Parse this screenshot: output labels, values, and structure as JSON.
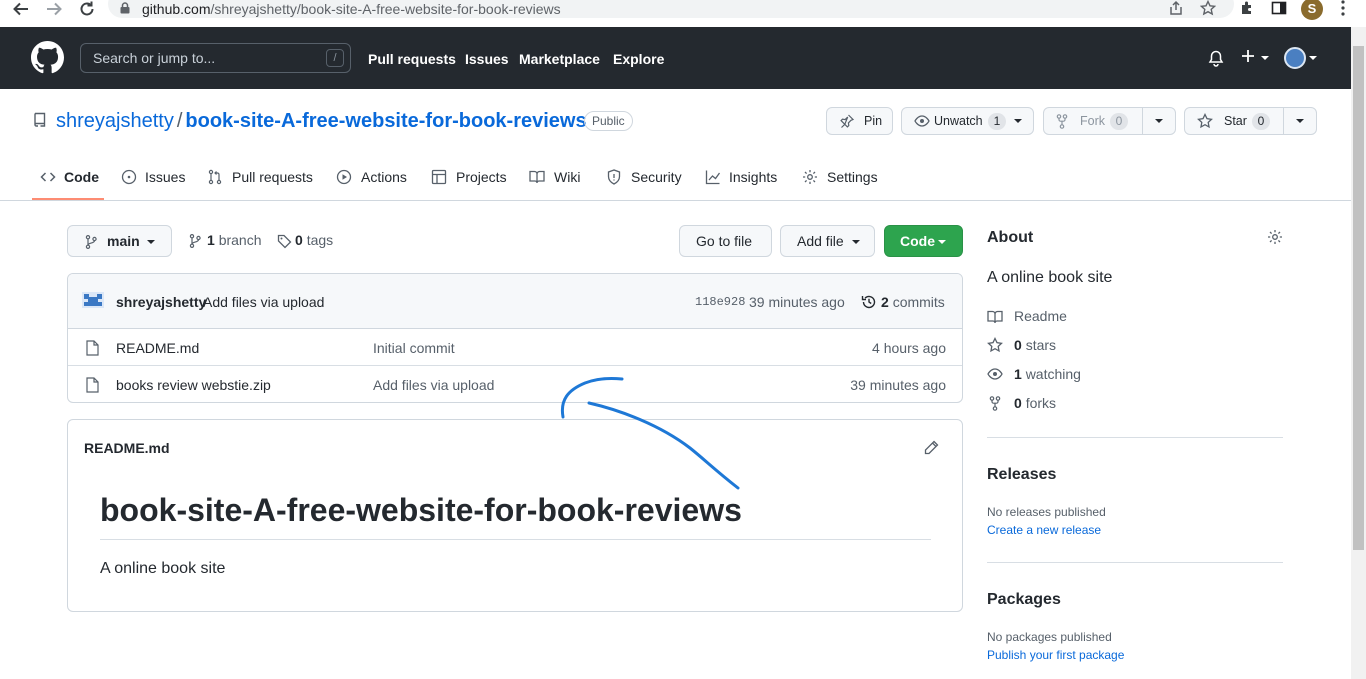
{
  "browser": {
    "url_host": "github.com",
    "url_path": "/shreyajshetty/book-site-A-free-website-for-book-reviews",
    "profile_initial": "S"
  },
  "header": {
    "search_placeholder": "Search or jump to...",
    "slash_key": "/",
    "nav": [
      "Pull requests",
      "Issues",
      "Marketplace",
      "Explore"
    ],
    "plus": "+"
  },
  "repo": {
    "owner": "shreyajshetty",
    "separator": "/",
    "name": "book-site-A-free-website-for-book-reviews",
    "visibility": "Public",
    "pin_label": "Pin",
    "unwatch_label": "Unwatch",
    "watch_count": "1",
    "fork_label": "Fork",
    "fork_count": "0",
    "star_label": "Star",
    "star_count": "0"
  },
  "tabs": [
    {
      "label": "Code",
      "icon": "code-icon"
    },
    {
      "label": "Issues",
      "icon": "issue-icon"
    },
    {
      "label": "Pull requests",
      "icon": "pull-request-icon"
    },
    {
      "label": "Actions",
      "icon": "play-icon"
    },
    {
      "label": "Projects",
      "icon": "table-icon"
    },
    {
      "label": "Wiki",
      "icon": "book-icon"
    },
    {
      "label": "Security",
      "icon": "shield-icon"
    },
    {
      "label": "Insights",
      "icon": "graph-icon"
    },
    {
      "label": "Settings",
      "icon": "gear-icon"
    }
  ],
  "toolbar": {
    "branch": "main",
    "branch_count": "1",
    "branch_word": "branch",
    "tag_count": "0",
    "tag_word": "tags",
    "go_to_file": "Go to file",
    "add_file": "Add file",
    "code": "Code"
  },
  "latest_commit": {
    "author": "shreyajshetty",
    "message": "Add files via upload",
    "sha": "118e928",
    "time": "39 minutes ago",
    "commit_count": "2",
    "commit_word": "commits"
  },
  "files": [
    {
      "name": "README.md",
      "message": "Initial commit",
      "time": "4 hours ago"
    },
    {
      "name": "books review webstie.zip",
      "message": "Add files via upload",
      "time": "39 minutes ago"
    }
  ],
  "readme": {
    "filename": "README.md",
    "heading": "book-site-A-free-website-for-book-reviews",
    "body": "A online book site"
  },
  "about": {
    "title": "About",
    "description": "A online book site",
    "readme": "Readme",
    "stars_count": "0",
    "stars_word": "stars",
    "watching_count": "1",
    "watching_word": "watching",
    "forks_count": "0",
    "forks_word": "forks"
  },
  "releases": {
    "title": "Releases",
    "empty": "No releases published",
    "link": "Create a new release"
  },
  "packages": {
    "title": "Packages",
    "empty": "No packages published",
    "link": "Publish your first package"
  },
  "colors": {
    "header_bg": "#24292f",
    "link": "#0969da",
    "green_button": "#2da44e",
    "tab_underline": "#fd8c73",
    "annotation_stroke": "#1e78d6"
  }
}
